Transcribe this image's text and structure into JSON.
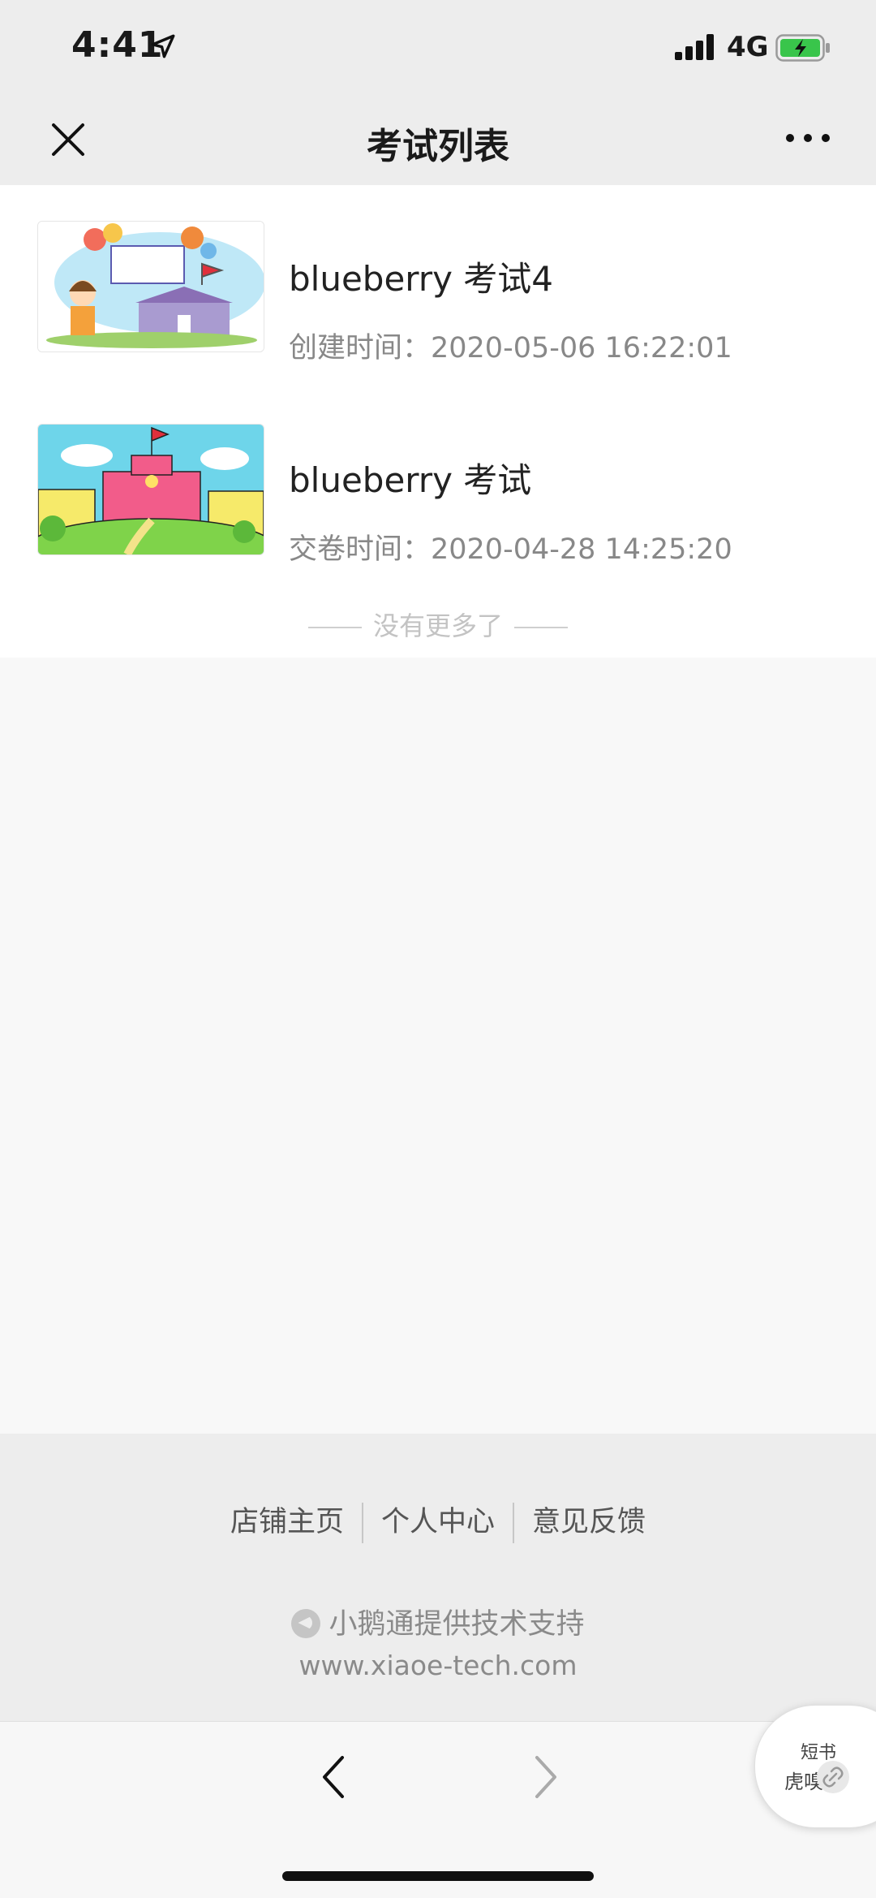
{
  "status_bar": {
    "time": "4:41",
    "network": "4G",
    "icons": [
      "location-arrow-icon",
      "signal-bars-icon",
      "battery-charging-icon"
    ],
    "battery_color": "#39c54b"
  },
  "nav": {
    "title": "考试列表",
    "close_icon": "close-icon",
    "more_icon": "more-dots-icon"
  },
  "exam_list": {
    "items": [
      {
        "title": "blueberry 考试4",
        "meta": "创建时间：2020-05-06 16:22:01"
      },
      {
        "title": "blueberry 考试",
        "meta": "交卷时间：2020-04-28 14:25:20"
      }
    ],
    "end_text": "没有更多了"
  },
  "footer": {
    "links": [
      "店铺主页",
      "个人中心",
      "意见反馈"
    ],
    "support_text": "小鹅通提供技术支持",
    "site": "www.xiaoe-tech.com"
  },
  "floating_widget": {
    "line1": "短书",
    "line2": "虎嗅",
    "icon": "link-icon"
  },
  "toolbar": {
    "back_icon": "chevron-left-icon",
    "forward_icon": "chevron-right-icon"
  }
}
